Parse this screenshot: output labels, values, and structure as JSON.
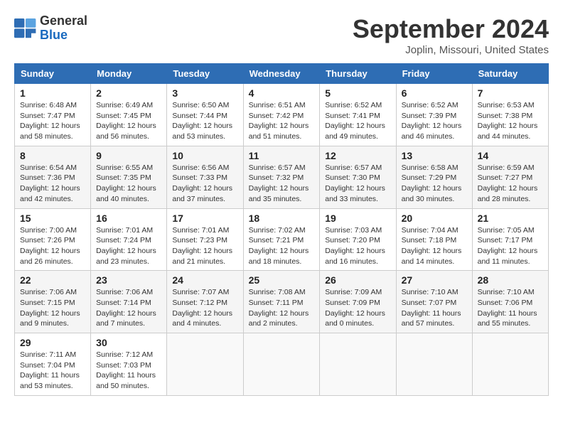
{
  "header": {
    "logo_general": "General",
    "logo_blue": "Blue",
    "month_title": "September 2024",
    "location": "Joplin, Missouri, United States"
  },
  "calendar": {
    "days_of_week": [
      "Sunday",
      "Monday",
      "Tuesday",
      "Wednesday",
      "Thursday",
      "Friday",
      "Saturday"
    ],
    "weeks": [
      [
        {
          "day": "1",
          "info": "Sunrise: 6:48 AM\nSunset: 7:47 PM\nDaylight: 12 hours and 58 minutes."
        },
        {
          "day": "2",
          "info": "Sunrise: 6:49 AM\nSunset: 7:45 PM\nDaylight: 12 hours and 56 minutes."
        },
        {
          "day": "3",
          "info": "Sunrise: 6:50 AM\nSunset: 7:44 PM\nDaylight: 12 hours and 53 minutes."
        },
        {
          "day": "4",
          "info": "Sunrise: 6:51 AM\nSunset: 7:42 PM\nDaylight: 12 hours and 51 minutes."
        },
        {
          "day": "5",
          "info": "Sunrise: 6:52 AM\nSunset: 7:41 PM\nDaylight: 12 hours and 49 minutes."
        },
        {
          "day": "6",
          "info": "Sunrise: 6:52 AM\nSunset: 7:39 PM\nDaylight: 12 hours and 46 minutes."
        },
        {
          "day": "7",
          "info": "Sunrise: 6:53 AM\nSunset: 7:38 PM\nDaylight: 12 hours and 44 minutes."
        }
      ],
      [
        {
          "day": "8",
          "info": "Sunrise: 6:54 AM\nSunset: 7:36 PM\nDaylight: 12 hours and 42 minutes."
        },
        {
          "day": "9",
          "info": "Sunrise: 6:55 AM\nSunset: 7:35 PM\nDaylight: 12 hours and 40 minutes."
        },
        {
          "day": "10",
          "info": "Sunrise: 6:56 AM\nSunset: 7:33 PM\nDaylight: 12 hours and 37 minutes."
        },
        {
          "day": "11",
          "info": "Sunrise: 6:57 AM\nSunset: 7:32 PM\nDaylight: 12 hours and 35 minutes."
        },
        {
          "day": "12",
          "info": "Sunrise: 6:57 AM\nSunset: 7:30 PM\nDaylight: 12 hours and 33 minutes."
        },
        {
          "day": "13",
          "info": "Sunrise: 6:58 AM\nSunset: 7:29 PM\nDaylight: 12 hours and 30 minutes."
        },
        {
          "day": "14",
          "info": "Sunrise: 6:59 AM\nSunset: 7:27 PM\nDaylight: 12 hours and 28 minutes."
        }
      ],
      [
        {
          "day": "15",
          "info": "Sunrise: 7:00 AM\nSunset: 7:26 PM\nDaylight: 12 hours and 26 minutes."
        },
        {
          "day": "16",
          "info": "Sunrise: 7:01 AM\nSunset: 7:24 PM\nDaylight: 12 hours and 23 minutes."
        },
        {
          "day": "17",
          "info": "Sunrise: 7:01 AM\nSunset: 7:23 PM\nDaylight: 12 hours and 21 minutes."
        },
        {
          "day": "18",
          "info": "Sunrise: 7:02 AM\nSunset: 7:21 PM\nDaylight: 12 hours and 18 minutes."
        },
        {
          "day": "19",
          "info": "Sunrise: 7:03 AM\nSunset: 7:20 PM\nDaylight: 12 hours and 16 minutes."
        },
        {
          "day": "20",
          "info": "Sunrise: 7:04 AM\nSunset: 7:18 PM\nDaylight: 12 hours and 14 minutes."
        },
        {
          "day": "21",
          "info": "Sunrise: 7:05 AM\nSunset: 7:17 PM\nDaylight: 12 hours and 11 minutes."
        }
      ],
      [
        {
          "day": "22",
          "info": "Sunrise: 7:06 AM\nSunset: 7:15 PM\nDaylight: 12 hours and 9 minutes."
        },
        {
          "day": "23",
          "info": "Sunrise: 7:06 AM\nSunset: 7:14 PM\nDaylight: 12 hours and 7 minutes."
        },
        {
          "day": "24",
          "info": "Sunrise: 7:07 AM\nSunset: 7:12 PM\nDaylight: 12 hours and 4 minutes."
        },
        {
          "day": "25",
          "info": "Sunrise: 7:08 AM\nSunset: 7:11 PM\nDaylight: 12 hours and 2 minutes."
        },
        {
          "day": "26",
          "info": "Sunrise: 7:09 AM\nSunset: 7:09 PM\nDaylight: 12 hours and 0 minutes."
        },
        {
          "day": "27",
          "info": "Sunrise: 7:10 AM\nSunset: 7:07 PM\nDaylight: 11 hours and 57 minutes."
        },
        {
          "day": "28",
          "info": "Sunrise: 7:10 AM\nSunset: 7:06 PM\nDaylight: 11 hours and 55 minutes."
        }
      ],
      [
        {
          "day": "29",
          "info": "Sunrise: 7:11 AM\nSunset: 7:04 PM\nDaylight: 11 hours and 53 minutes."
        },
        {
          "day": "30",
          "info": "Sunrise: 7:12 AM\nSunset: 7:03 PM\nDaylight: 11 hours and 50 minutes."
        },
        {
          "day": "",
          "info": ""
        },
        {
          "day": "",
          "info": ""
        },
        {
          "day": "",
          "info": ""
        },
        {
          "day": "",
          "info": ""
        },
        {
          "day": "",
          "info": ""
        }
      ]
    ]
  }
}
